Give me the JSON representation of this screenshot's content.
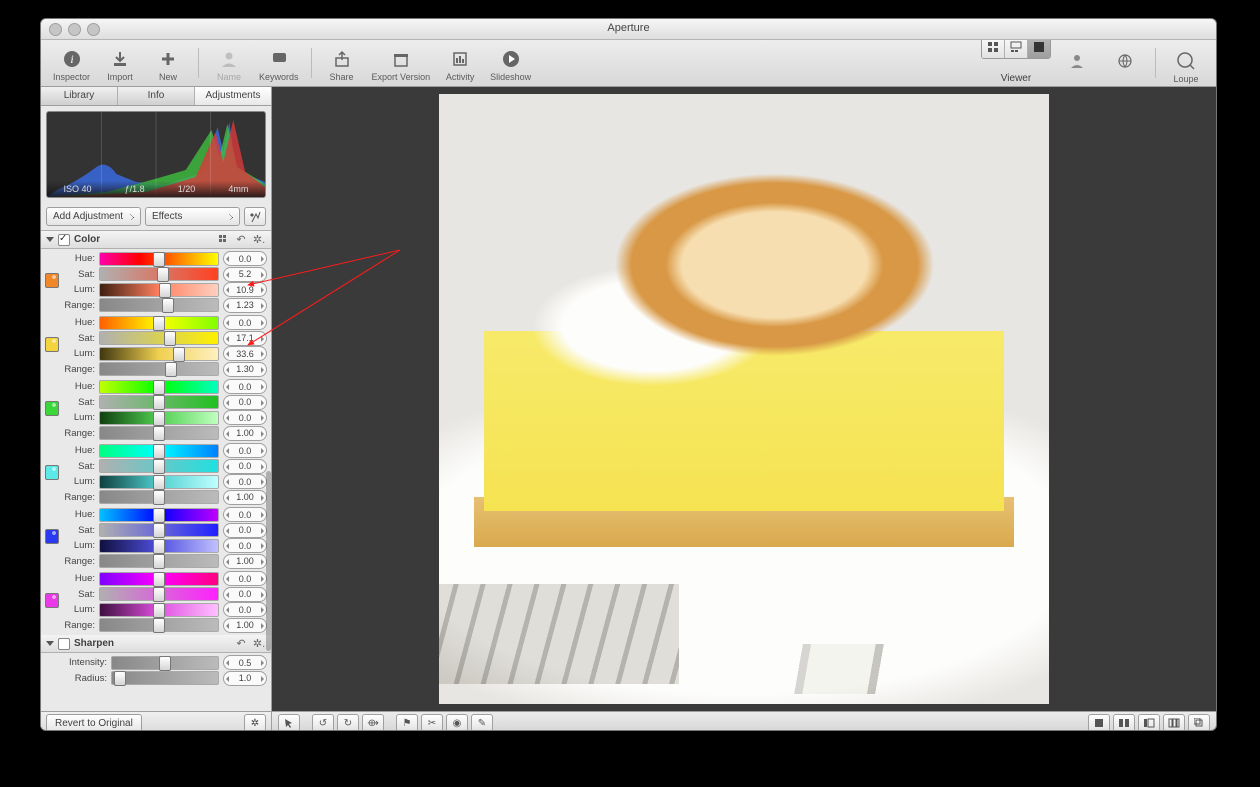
{
  "window": {
    "title": "Aperture"
  },
  "toolbar_left": [
    {
      "label": "Inspector",
      "icon": "info"
    },
    {
      "label": "Import",
      "icon": "import"
    },
    {
      "label": "New",
      "icon": "plus"
    },
    {
      "sep": true
    },
    {
      "label": "Name",
      "icon": "person",
      "disabled": true
    },
    {
      "label": "Keywords",
      "icon": "tag"
    },
    {
      "sep": true
    },
    {
      "label": "Share",
      "icon": "share"
    },
    {
      "label": "Export Version",
      "icon": "box"
    },
    {
      "label": "Activity",
      "icon": "activity"
    },
    {
      "label": "Slideshow",
      "icon": "play"
    }
  ],
  "toolbar_right": {
    "viewer_label": "Viewer",
    "loupe_label": "Loupe"
  },
  "tabs": [
    {
      "label": "Library",
      "active": false
    },
    {
      "label": "Info",
      "active": false
    },
    {
      "label": "Adjustments",
      "active": true
    }
  ],
  "exif": {
    "iso": "ISO 40",
    "aperture": "ƒ/1.8",
    "shutter": "1/20",
    "focal": "4mm"
  },
  "dropdowns": {
    "add_adjustment": "Add Adjustment",
    "effects": "Effects"
  },
  "panels": {
    "color": {
      "title": "Color",
      "checked": true
    },
    "sharpen": {
      "title": "Sharpen",
      "checked": false
    }
  },
  "slider_labels": {
    "hue": "Hue:",
    "sat": "Sat:",
    "lum": "Lum:",
    "range": "Range:",
    "intensity": "Intensity:",
    "radius": "Radius:"
  },
  "color_groups": [
    {
      "swatch": "#f0882a",
      "hue": {
        "v": "0.0",
        "pos": 50
      },
      "sat": {
        "v": "5.2",
        "pos": 53
      },
      "lum": {
        "v": "10.9",
        "pos": 55
      },
      "range": {
        "v": "1.23",
        "pos": 58
      },
      "hue_grad": "grad-hue-red",
      "sat_grad": "grad-sat-r",
      "lum_grad": "grad-lum-r"
    },
    {
      "swatch": "#f3d43e",
      "hue": {
        "v": "0.0",
        "pos": 50
      },
      "sat": {
        "v": "17.1",
        "pos": 59
      },
      "lum": {
        "v": "33.6",
        "pos": 67
      },
      "range": {
        "v": "1.30",
        "pos": 60
      },
      "hue_grad": "grad-hue-yellow",
      "sat_grad": "grad-sat-y",
      "lum_grad": "grad-lum-y"
    },
    {
      "swatch": "#3ad63a",
      "hue": {
        "v": "0.0",
        "pos": 50
      },
      "sat": {
        "v": "0.0",
        "pos": 50
      },
      "lum": {
        "v": "0.0",
        "pos": 50
      },
      "range": {
        "v": "1.00",
        "pos": 50
      },
      "hue_grad": "grad-hue-green",
      "sat_grad": "grad-sat-g",
      "lum_grad": "grad-lum-g"
    },
    {
      "swatch": "#5de8e8",
      "hue": {
        "v": "0.0",
        "pos": 50
      },
      "sat": {
        "v": "0.0",
        "pos": 50
      },
      "lum": {
        "v": "0.0",
        "pos": 50
      },
      "range": {
        "v": "1.00",
        "pos": 50
      },
      "hue_grad": "grad-hue-cyan",
      "sat_grad": "grad-sat-c",
      "lum_grad": "grad-lum-c"
    },
    {
      "swatch": "#2a3af0",
      "hue": {
        "v": "0.0",
        "pos": 50
      },
      "sat": {
        "v": "0.0",
        "pos": 50
      },
      "lum": {
        "v": "0.0",
        "pos": 50
      },
      "range": {
        "v": "1.00",
        "pos": 50
      },
      "hue_grad": "grad-hue-blue",
      "sat_grad": "grad-sat-b",
      "lum_grad": "grad-lum-b"
    },
    {
      "swatch": "#e83ae8",
      "hue": {
        "v": "0.0",
        "pos": 50
      },
      "sat": {
        "v": "0.0",
        "pos": 50
      },
      "lum": {
        "v": "0.0",
        "pos": 50
      },
      "range": {
        "v": "1.00",
        "pos": 50
      },
      "hue_grad": "grad-hue-magenta",
      "sat_grad": "grad-sat-m",
      "lum_grad": "grad-lum-m"
    }
  ],
  "sharpen": {
    "intensity": {
      "v": "0.5",
      "pos": 50
    },
    "radius": {
      "v": "1.0",
      "pos": 8
    }
  },
  "footer": {
    "revert": "Revert to Original"
  }
}
